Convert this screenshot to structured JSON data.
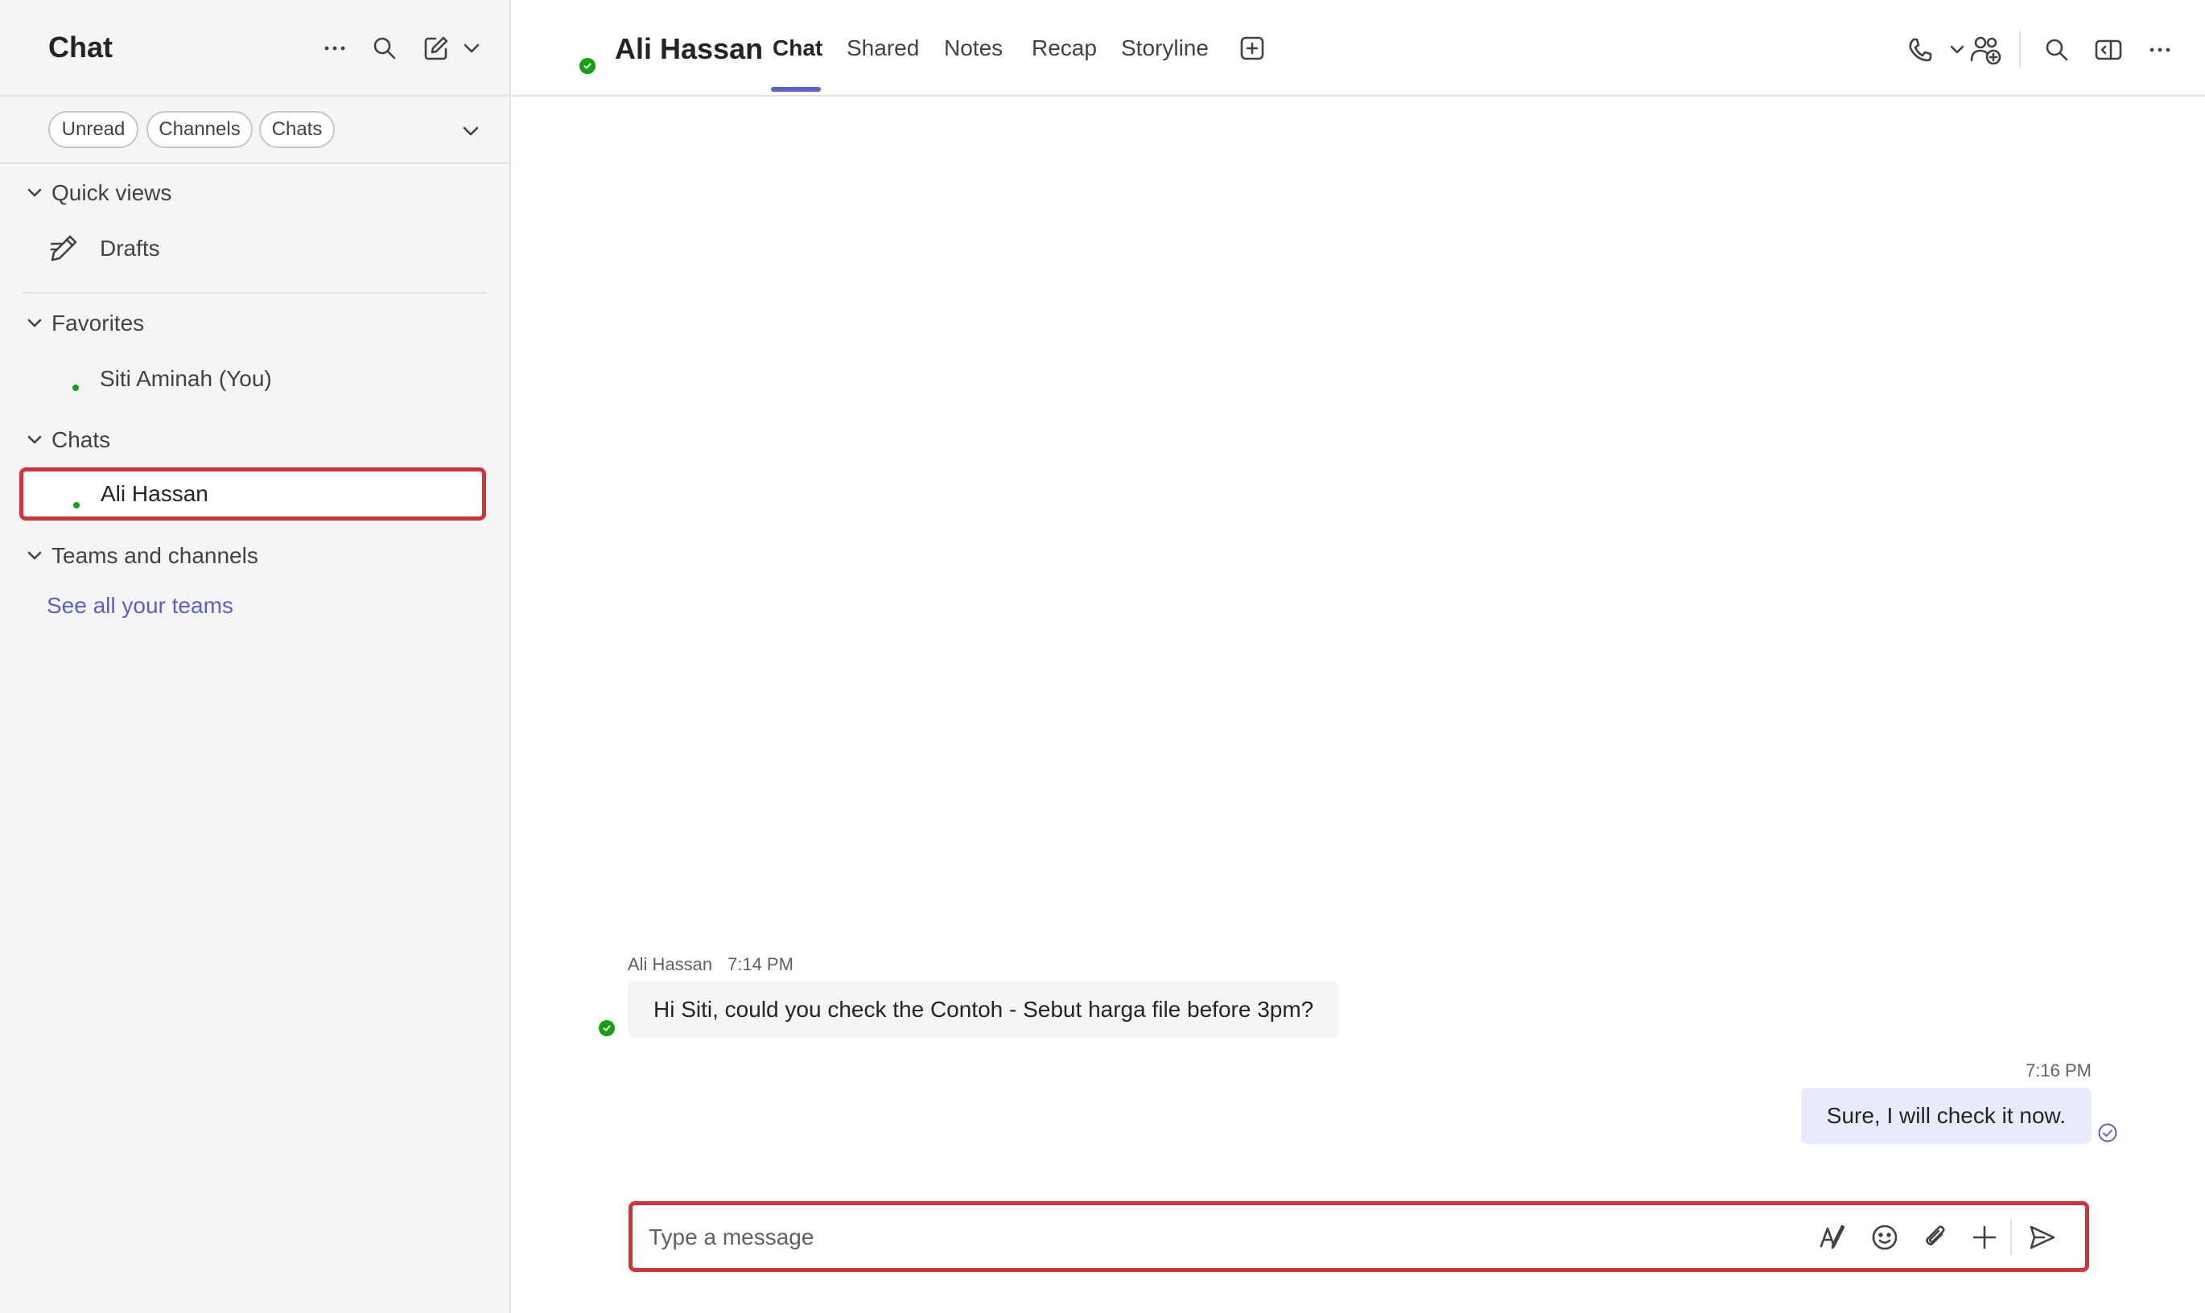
{
  "sidebar": {
    "title": "Chat",
    "header_icons": [
      "more-icon",
      "search-icon",
      "compose-icon",
      "chevron-down-icon"
    ],
    "filters": [
      "Unread",
      "Channels",
      "Chats"
    ],
    "sections": {
      "quick_views": {
        "label": "Quick views",
        "items": [
          {
            "label": "Drafts",
            "icon": "drafts-icon"
          }
        ]
      },
      "favorites": {
        "label": "Favorites",
        "items": [
          {
            "label": "Siti Aminah (You)",
            "presence": "available"
          }
        ]
      },
      "chats": {
        "label": "Chats",
        "items": [
          {
            "label": "Ali Hassan",
            "presence": "available",
            "selected": true
          }
        ]
      },
      "teams": {
        "label": "Teams and channels",
        "link": "See all your teams"
      }
    }
  },
  "conversation": {
    "contact_name": "Ali Hassan",
    "presence": "available",
    "tabs": [
      "Chat",
      "Shared",
      "Notes",
      "Recap",
      "Storyline"
    ],
    "active_tab": "Chat",
    "toolbar_icons": [
      "call-icon",
      "chevron-down-icon",
      "add-people-icon",
      "search-icon",
      "side-panel-icon",
      "more-icon"
    ]
  },
  "messages": [
    {
      "sender": "Ali Hassan",
      "time": "7:14 PM",
      "text": "Hi Siti, could you check the Contoh - Sebut harga file before 3pm?",
      "direction": "incoming"
    },
    {
      "sender": "",
      "time": "7:16 PM",
      "text": "Sure, I will check it now.",
      "direction": "outgoing",
      "status": "sent"
    }
  ],
  "compose": {
    "placeholder": "Type a message",
    "value": "",
    "icons": [
      "format-icon",
      "emoji-icon",
      "attach-icon",
      "add-icon",
      "send-icon"
    ]
  },
  "colors": {
    "accent": "#5b5fc7",
    "presence_available": "#13a10e",
    "highlight_outline": "#d13438",
    "outgoing_bubble": "#e8ebfa",
    "incoming_bubble": "#f5f5f5",
    "sidebar_bg": "#f5f5f5"
  }
}
